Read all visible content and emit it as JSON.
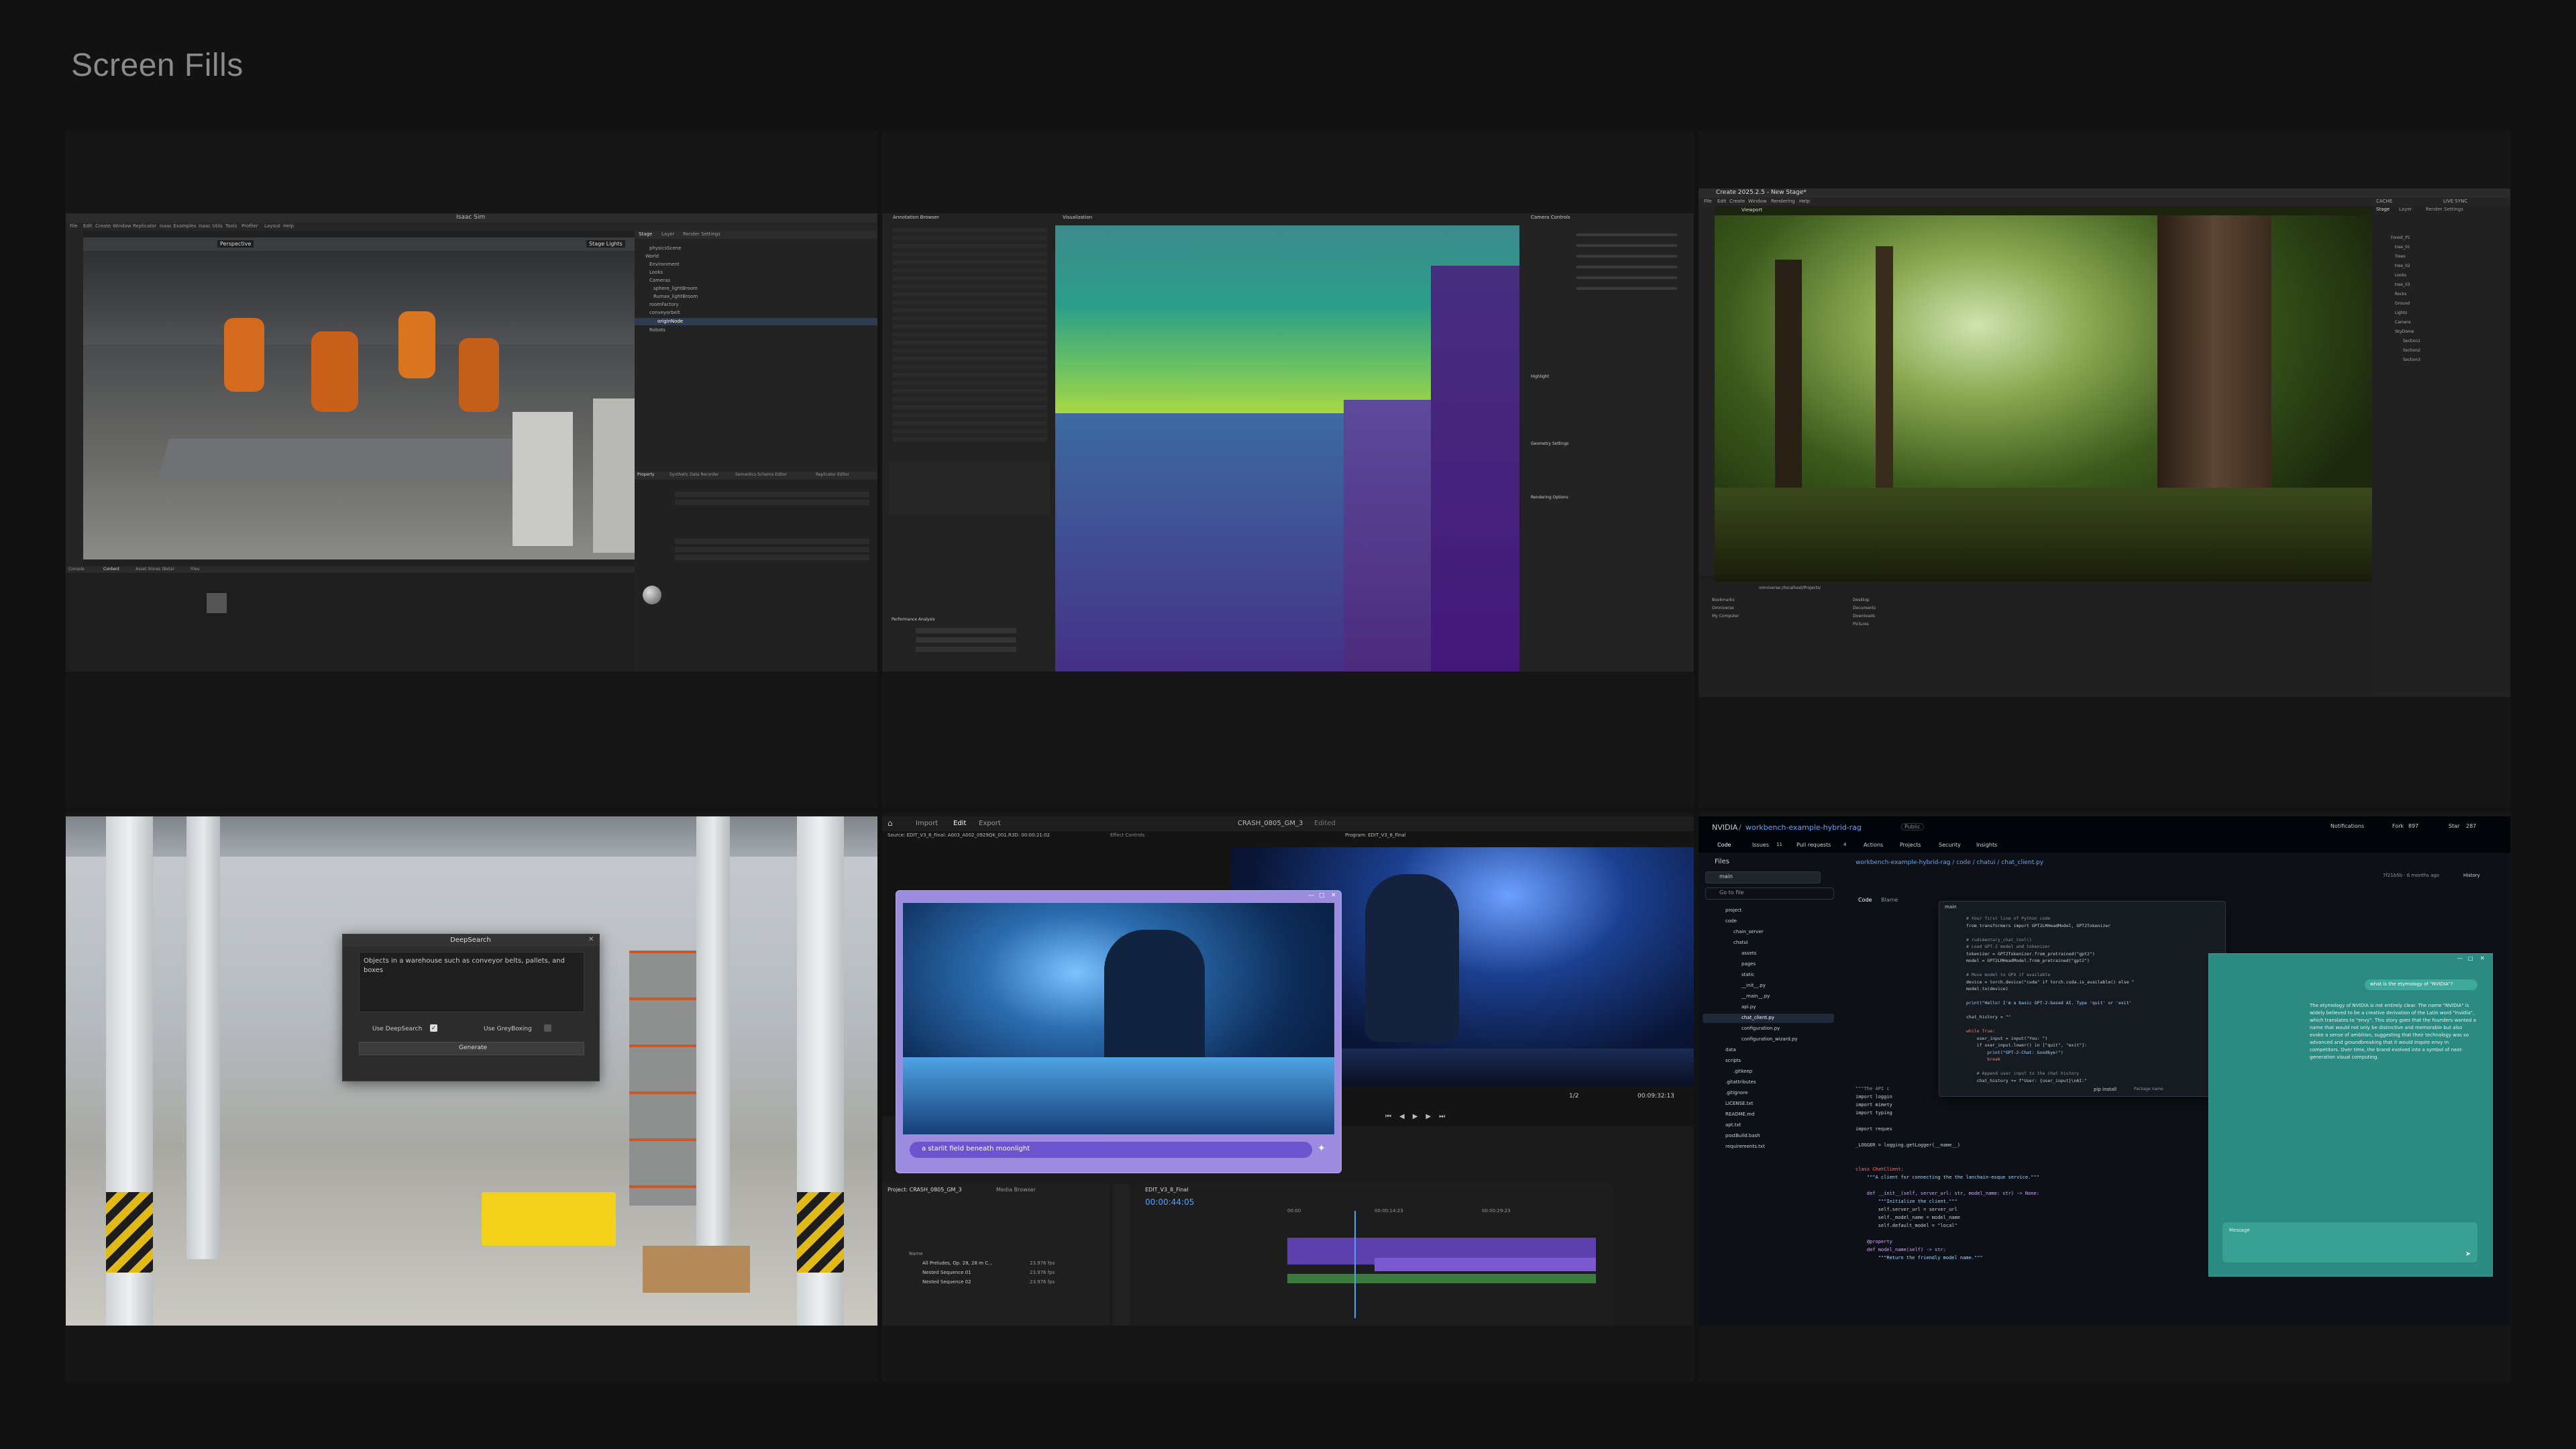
{
  "page": {
    "title": "Screen Fills"
  },
  "isaac": {
    "window_title": "Isaac Sim",
    "menu": [
      "File",
      "Edit",
      "Create",
      "Window",
      "Replicator",
      "Isaac Examples",
      "Isaac Utils",
      "Tools",
      "Profiler",
      "Layout",
      "Help"
    ],
    "stage_tabs": [
      "Stage",
      "Layer",
      "Render Settings"
    ],
    "viewport_label": "Perspective",
    "stage_lights": "Stage Lights",
    "stage_items": [
      "physicsScene",
      "World",
      "Environment",
      "Looks",
      "Cameras",
      "sphere_lightBroom",
      "Rumax_lightBroom",
      "roomFactory",
      "conveyorbelt",
      "Robots"
    ],
    "selected_item": "originNode",
    "bottom_tabs": [
      "Console",
      "Content",
      "Asset Stores (Beta)",
      "Files"
    ],
    "property_tabs": [
      "Property",
      "Synthetic Data Recorder",
      "Semantics Schema Editor",
      "Replicator Editor"
    ]
  },
  "depth": {
    "left_title": "Annotation Browser",
    "viewer_title": "Visualization",
    "right_title": "Camera Controls",
    "sections": [
      "Highlight",
      "Geometry Settings",
      "Rendering Options",
      "Performance Analysis"
    ]
  },
  "create": {
    "window_title": "Create 2025.2.5 - New Stage*",
    "menu": [
      "File",
      "Edit",
      "Create",
      "Window",
      "Rendering",
      "Help"
    ],
    "viewport_tab": "Viewport",
    "right_tab": "Stage",
    "right_tab2": "Layer",
    "right_tab3": "Render Settings",
    "cache": "CACHE",
    "live": "LIVE SYNC",
    "tree_items": [
      "Forest_P1",
      "tree_01",
      "Trees",
      "tree_02",
      "Looks",
      "tree_03",
      "Rocks",
      "Ground",
      "Lights",
      "Camera",
      "SkyDome",
      "Section1",
      "Section2",
      "Section3"
    ],
    "bottom_path": "omniverse://localhost/Projects/",
    "file_items": [
      "Bookmarks",
      "Omniverse",
      "My Computer"
    ],
    "folder_items": [
      "Desktop",
      "Documents",
      "Downloads",
      "Pictures"
    ]
  },
  "warehouse": {
    "dialog_title": "DeepSearch",
    "prompt_text": "Objects in a warehouse such as conveyor belts, pallets, and boxes",
    "option1": "Use DeepSearch",
    "option2": "Use GreyBoxing",
    "generate": "Generate"
  },
  "premiere": {
    "nav": [
      "Import",
      "Edit",
      "Export"
    ],
    "active_nav": "Edit",
    "project_title": "CRASH_0805_GM_3",
    "edited": "Edited",
    "source_label": "Source: EDIT_V3_8_Final: A003_A002_0929QK_001.R3D: 00:00:21:02",
    "effect_controls": "Effect Controls",
    "program_label": "Program: EDIT_V3_8_Final",
    "prompt_text": "a starlit field beneath moonlight",
    "zoom": "1/2",
    "timecode_right": "00:09:32:13",
    "timecode_timeline": "00:00:44:05",
    "project_panel": "Project: CRASH_0805_GM_3",
    "media_browser": "Media Browser",
    "timeline_tab": "EDIT_V3_8_Final",
    "bins": [
      "Name",
      "All Preludes, Op. 28, 28 m C...",
      "Nested Sequence 01",
      "Nested Sequence 02"
    ],
    "frame_rates": [
      "23.976 fps",
      "23.976 fps",
      "23.976 fps"
    ],
    "ruler": [
      "00:00",
      "00:00:14:23",
      "00:00:29:23"
    ]
  },
  "github": {
    "org": "NVIDIA",
    "repo": "workbench-example-hybrid-rag",
    "visibility": "Public",
    "notifications": "Notifications",
    "fork": "Fork",
    "fork_count": "897",
    "star": "Star",
    "star_count": "287",
    "tabs": [
      "Code",
      "Issues",
      "Pull requests",
      "Actions",
      "Projects",
      "Security",
      "Insights"
    ],
    "issues_count": "11",
    "pr_count": "4",
    "files_label": "Files",
    "branch": "main",
    "goto_file": "Go to file",
    "tree": [
      "project",
      "code",
      "chain_server",
      "chatui",
      "assets",
      "pages",
      "static",
      "__init__.py",
      "__main__.py",
      "api.py",
      "chat_client.py",
      "configuration.py",
      "configuration_wizard.py",
      "data",
      "scripts",
      ".gitkeep",
      ".gitattributes",
      ".gitignore",
      "LICENSE.txt",
      "README.md",
      "apt.txt",
      "postBuild.bash",
      "requirements.txt"
    ],
    "breadcrumb": "workbench-example-hybrid-rag / code / chatui / chat_client.py",
    "code_tabs": [
      "Code",
      "Blame"
    ],
    "commit_hint": "7f21b5b · 6 months ago",
    "history": "History",
    "popup_branch": "main",
    "popup_code": [
      "# Your first line of Python code",
      "from transformers import GPT2LMHeadModel, GPT2Tokenizer",
      "",
      "# rudimentary_chat_tool()",
      "# Load GPT-2 model and tokenizer",
      "tokenizer = GPT2Tokenizer.from_pretrained(\"gpt2\")",
      "model = GPT2LMHeadModel.from_pretrained(\"gpt2\")",
      "",
      "# Move model to GPU if available",
      "device = torch.device(\"cuda\" if torch.cuda.is_available() else \"",
      "model.to(device)",
      "",
      "print(\"Hello! I'm a basic GPT-2-based AI. Type 'quit' or 'exit'",
      "",
      "chat_history = \"\"",
      "",
      "while True:",
      "    user_input = input(\"You: \")",
      "    if user_input.lower() in [\"quit\", \"exit\"]:",
      "        print(\"GPT-2-Chat: Goodbye!\")",
      "        break",
      "",
      "    # Append user input to the chat history",
      "    chat_history += f\"User: {user_input}\\nAI:\""
    ],
    "popup_footer": "pip install",
    "popup_footer2": "Package name",
    "code_lines": [
      "\"\"\"The API c",
      "import loggin",
      "import mimety",
      "import typing",
      "",
      "import reques",
      "",
      "_LOGGER = logging.getLogger(__name__)",
      "",
      "",
      "class ChatClient:",
      "    \"\"\"A client for connecting the the lanchain-esque service.\"\"\"",
      "",
      "    def __init__(self, server_url: str, model_name: str) -> None:",
      "        \"\"\"Initialize the client.\"\"\"",
      "        self.server_url = server_url",
      "        self._model_name = model_name",
      "        self.default_model = \"local\"",
      "",
      "    @property",
      "    def model_name(self) -> str:",
      "        \"\"\"Return the friendly model name.\"\"\""
    ],
    "chat_user": "what is the etymology of \"NVIDIA\"?",
    "chat_answer": "The etymology of NVIDIA is not entirely clear. The name \"NVIDIA\" is widely believed to be a creative derivation of the Latin word \"invidia\", which translates to \"envy\". This story goes that the founders wanted a name that would not only be distinctive and memorable but also evoke a sense of ambition, suggesting that their technology was so advanced and groundbreaking that it would inspire envy in competitors. Over time, the brand evolved into a symbol of next-generation visual computing.",
    "chat_input": "Message"
  }
}
